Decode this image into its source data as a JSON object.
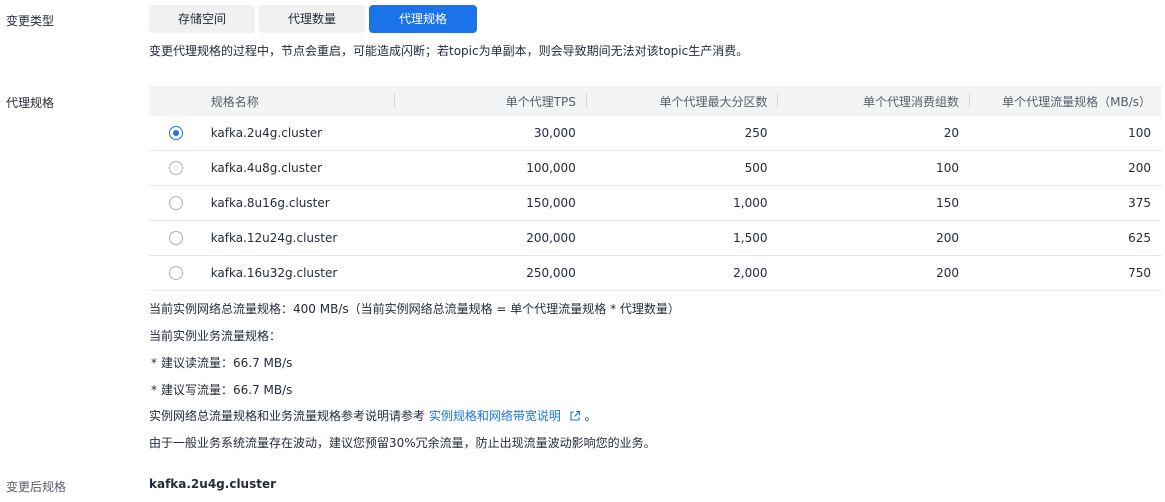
{
  "change_type": {
    "label": "变更类型",
    "tabs": [
      "存储空间",
      "代理数量",
      "代理规格"
    ],
    "notice": "变更代理规格的过程中，节点会重启，可能造成闪断；若topic为单副本，则会导致期间无法对该topic生产消费。"
  },
  "spec": {
    "label": "代理规格",
    "columns": [
      "规格名称",
      "单个代理TPS",
      "单个代理最大分区数",
      "单个代理消费组数",
      "单个代理流量规格（MB/s）"
    ],
    "rows": [
      {
        "name": "kafka.2u4g.cluster",
        "tps": "30,000",
        "partitions": "250",
        "groups": "20",
        "flow": "100",
        "selected": true
      },
      {
        "name": "kafka.4u8g.cluster",
        "tps": "100,000",
        "partitions": "500",
        "groups": "100",
        "flow": "200",
        "selected": false
      },
      {
        "name": "kafka.8u16g.cluster",
        "tps": "150,000",
        "partitions": "1,000",
        "groups": "150",
        "flow": "375",
        "selected": false
      },
      {
        "name": "kafka.12u24g.cluster",
        "tps": "200,000",
        "partitions": "1,500",
        "groups": "200",
        "flow": "625",
        "selected": false
      },
      {
        "name": "kafka.16u32g.cluster",
        "tps": "250,000",
        "partitions": "2,000",
        "groups": "200",
        "flow": "750",
        "selected": false
      }
    ]
  },
  "info": {
    "total_flow": "当前实例网络总流量规格：400 MB/s（当前实例网络总流量规格 = 单个代理流量规格 * 代理数量）",
    "business_flow_title": "当前实例业务流量规格：",
    "read_flow": "建议读流量：66.7 MB/s",
    "write_flow": "建议写流量：66.7 MB/s",
    "bullet": "*",
    "reference_prefix": "实例网络总流量规格和业务流量规格参考说明请参考",
    "reference_link": "实例规格和网络带宽说明",
    "reference_suffix": "。",
    "redundancy_tip": "由于一般业务系统流量存在波动，建议您预留30%冗余流量，防止出现流量波动影响您的业务。"
  },
  "after": {
    "label": "变更后规格",
    "value": "kafka.2u4g.cluster"
  },
  "colors": {
    "accent": "#1a73e8",
    "header_bg": "#f3f4f6",
    "tab_bg": "#f1f1f1"
  }
}
